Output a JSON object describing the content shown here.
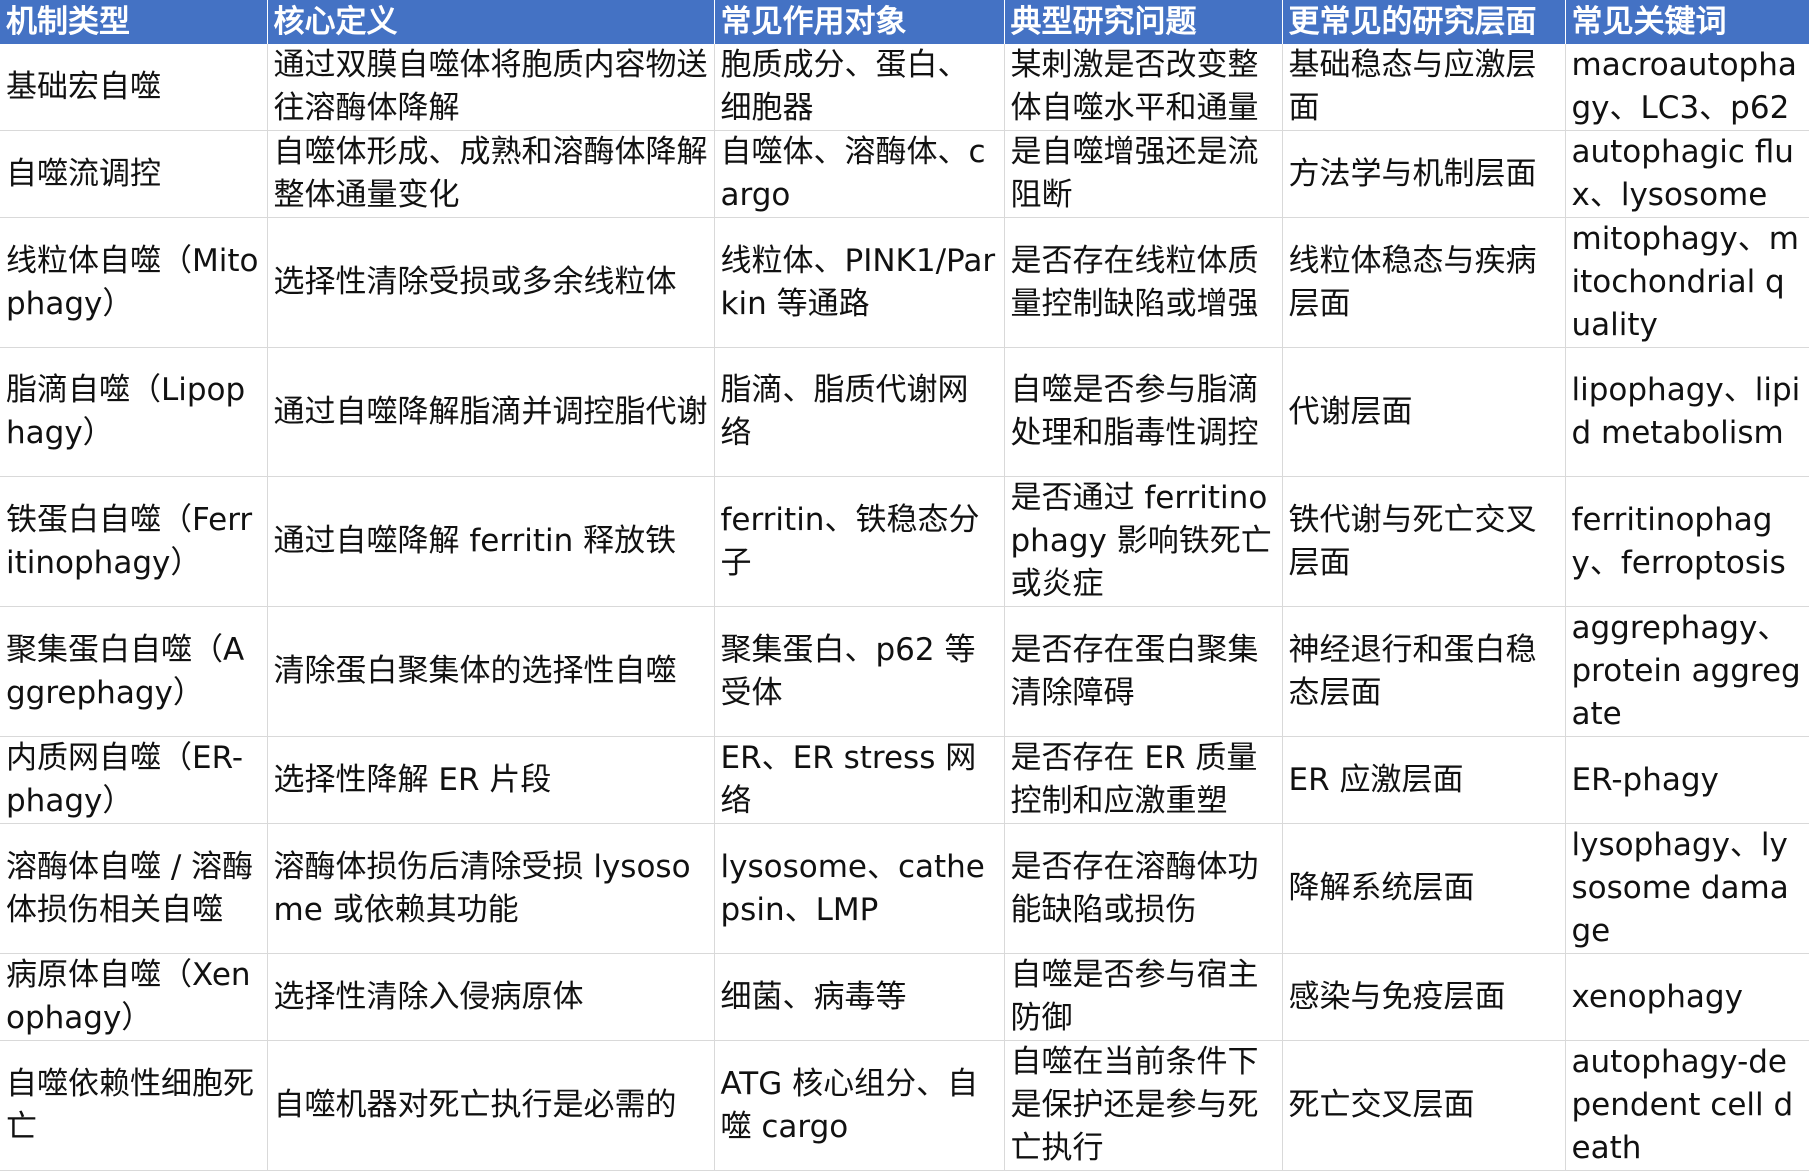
{
  "table": {
    "headers": [
      "机制类型",
      "核心定义",
      "常见作用对象",
      "典型研究问题",
      "更常见的研究层面",
      "常见关键词"
    ],
    "rows": [
      [
        "基础宏自噬",
        "通过双膜自噬体将胞质内容物送往溶酶体降解",
        "胞质成分、蛋白、细胞器",
        "某刺激是否改变整体自噬水平和通量",
        "基础稳态与应激层面",
        "macroautophagy、LC3、p62"
      ],
      [
        "自噬流调控",
        "自噬体形成、成熟和溶酶体降解整体通量变化",
        "自噬体、溶酶体、cargo",
        "是自噬增强还是流阻断",
        "方法学与机制层面",
        "autophagic flux、lysosome"
      ],
      [
        "线粒体自噬（Mitophagy）",
        "选择性清除受损或多余线粒体",
        "线粒体、PINK1/Parkin 等通路",
        "是否存在线粒体质量控制缺陷或增强",
        "线粒体稳态与疾病层面",
        "mitophagy、mitochondrial quality"
      ],
      [
        "脂滴自噬（Lipophagy）",
        "通过自噬降解脂滴并调控脂代谢",
        "脂滴、脂质代谢网络",
        "自噬是否参与脂滴处理和脂毒性调控",
        "代谢层面",
        "lipophagy、lipid metabolism"
      ],
      [
        "铁蛋白自噬（Ferritinophagy）",
        "通过自噬降解 ferritin 释放铁",
        "ferritin、铁稳态分子",
        "是否通过 ferritinophagy 影响铁死亡或炎症",
        "铁代谢与死亡交叉层面",
        "ferritinophagy、ferroptosis"
      ],
      [
        "聚集蛋白自噬（Aggrephagy）",
        "清除蛋白聚集体的选择性自噬",
        "聚集蛋白、p62 等受体",
        "是否存在蛋白聚集清除障碍",
        "神经退行和蛋白稳态层面",
        "aggrephagy、protein aggregate"
      ],
      [
        "内质网自噬（ER-phagy）",
        "选择性降解 ER 片段",
        "ER、ER stress 网络",
        "是否存在 ER 质量控制和应激重塑",
        "ER 应激层面",
        "ER-phagy"
      ],
      [
        "溶酶体自噬 / 溶酶体损伤相关自噬",
        "溶酶体损伤后清除受损 lysosome 或依赖其功能",
        "lysosome、cathepsin、LMP",
        "是否存在溶酶体功能缺陷或损伤",
        "降解系统层面",
        "lysophagy、lysosome damage"
      ],
      [
        "病原体自噬（Xenophagy）",
        "选择性清除入侵病原体",
        "细菌、病毒等",
        "自噬是否参与宿主防御",
        "感染与免疫层面",
        "xenophagy"
      ],
      [
        "自噬依赖性细胞死亡",
        "自噬机器对死亡执行是必需的",
        "ATG 核心组分、自噬 cargo",
        "自噬在当前条件下是保护还是参与死亡执行",
        "死亡交叉层面",
        "autophagy-dependent cell death"
      ]
    ]
  }
}
